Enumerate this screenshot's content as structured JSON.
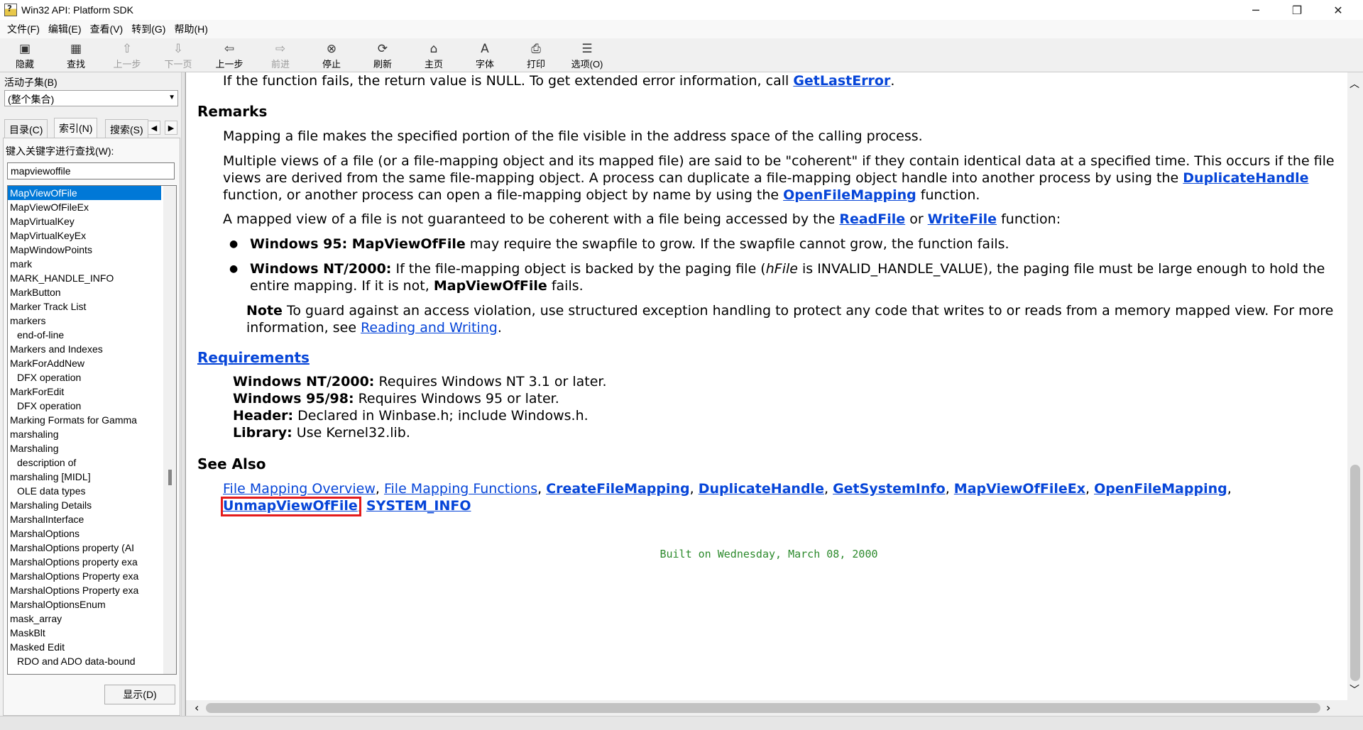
{
  "window": {
    "title": "Win32 API: Platform SDK",
    "minimize": "─",
    "maximize": "❐",
    "close": "✕"
  },
  "menu": [
    "文件(F)",
    "编辑(E)",
    "查看(V)",
    "转到(G)",
    "帮助(H)"
  ],
  "toolbar": [
    {
      "label": "隐藏",
      "icon": "hide-icon",
      "glyph": "▣",
      "enabled": true
    },
    {
      "label": "查找",
      "icon": "find-icon",
      "glyph": "▦",
      "enabled": true
    },
    {
      "label": "上一步",
      "icon": "up-arrow-icon",
      "glyph": "⇧",
      "enabled": false
    },
    {
      "label": "下一页",
      "icon": "down-arrow-icon",
      "glyph": "⇩",
      "enabled": false
    },
    {
      "label": "上一步",
      "icon": "back-arrow-icon",
      "glyph": "⇦",
      "enabled": true
    },
    {
      "label": "前进",
      "icon": "forward-arrow-icon",
      "glyph": "⇨",
      "enabled": false
    },
    {
      "label": "停止",
      "icon": "stop-icon",
      "glyph": "⊗",
      "enabled": true
    },
    {
      "label": "刷新",
      "icon": "refresh-icon",
      "glyph": "⟳",
      "enabled": true
    },
    {
      "label": "主页",
      "icon": "home-icon",
      "glyph": "⌂",
      "enabled": true
    },
    {
      "label": "字体",
      "icon": "font-icon",
      "glyph": "A",
      "enabled": true
    },
    {
      "label": "打印",
      "icon": "print-icon",
      "glyph": "⎙",
      "enabled": true
    },
    {
      "label": "选项(O)",
      "icon": "options-icon",
      "glyph": "☰",
      "enabled": true
    }
  ],
  "left": {
    "subset_label": "活动子集(B)",
    "subset_value": "(整个集合)",
    "tabs": {
      "contents": "目录(C)",
      "index": "索引(N)",
      "search": "搜索(S)"
    },
    "keyword_label": "键入关键字进行查找(W):",
    "keyword_value": "mapviewoffile",
    "items": [
      {
        "t": "MapViewOfFile",
        "sub": false,
        "sel": true
      },
      {
        "t": "MapViewOfFileEx",
        "sub": false,
        "sel": false
      },
      {
        "t": "MapVirtualKey",
        "sub": false,
        "sel": false
      },
      {
        "t": "MapVirtualKeyEx",
        "sub": false,
        "sel": false
      },
      {
        "t": "MapWindowPoints",
        "sub": false,
        "sel": false
      },
      {
        "t": "mark",
        "sub": false,
        "sel": false
      },
      {
        "t": "MARK_HANDLE_INFO",
        "sub": false,
        "sel": false
      },
      {
        "t": "MarkButton",
        "sub": false,
        "sel": false
      },
      {
        "t": "Marker Track List",
        "sub": false,
        "sel": false
      },
      {
        "t": "markers",
        "sub": false,
        "sel": false
      },
      {
        "t": "end-of-line",
        "sub": true,
        "sel": false
      },
      {
        "t": "Markers and Indexes",
        "sub": false,
        "sel": false
      },
      {
        "t": "MarkForAddNew",
        "sub": false,
        "sel": false
      },
      {
        "t": "DFX operation",
        "sub": true,
        "sel": false
      },
      {
        "t": "MarkForEdit",
        "sub": false,
        "sel": false
      },
      {
        "t": "DFX operation",
        "sub": true,
        "sel": false
      },
      {
        "t": "Marking Formats for Gamma",
        "sub": false,
        "sel": false
      },
      {
        "t": "marshaling",
        "sub": false,
        "sel": false
      },
      {
        "t": "Marshaling",
        "sub": false,
        "sel": false
      },
      {
        "t": "description of",
        "sub": true,
        "sel": false
      },
      {
        "t": "marshaling [MIDL]",
        "sub": false,
        "sel": false
      },
      {
        "t": "OLE data types",
        "sub": true,
        "sel": false
      },
      {
        "t": "Marshaling Details",
        "sub": false,
        "sel": false
      },
      {
        "t": "MarshalInterface",
        "sub": false,
        "sel": false
      },
      {
        "t": "MarshalOptions",
        "sub": false,
        "sel": false
      },
      {
        "t": "MarshalOptions property (AI",
        "sub": false,
        "sel": false
      },
      {
        "t": "MarshalOptions property exa",
        "sub": false,
        "sel": false
      },
      {
        "t": "MarshalOptions Property exa",
        "sub": false,
        "sel": false
      },
      {
        "t": "MarshalOptions Property exa",
        "sub": false,
        "sel": false
      },
      {
        "t": "MarshalOptionsEnum",
        "sub": false,
        "sel": false
      },
      {
        "t": "mask_array",
        "sub": false,
        "sel": false
      },
      {
        "t": "MaskBlt",
        "sub": false,
        "sel": false
      },
      {
        "t": "Masked Edit",
        "sub": false,
        "sel": false
      },
      {
        "t": "RDO and ADO data-bound",
        "sub": true,
        "sel": false
      }
    ],
    "display_button": "显示(D)"
  },
  "doc": {
    "fail_text": "If the function fails, the return value is NULL. To get extended error information, call ",
    "fail_link": "GetLastError",
    "remarks_heading": "Remarks",
    "remarks_p1": "Mapping a file makes the specified portion of the file visible in the address space of the calling process.",
    "remarks_p2a": "Multiple views of a file (or a file-mapping object and its mapped file) are said to be \"coherent\" if they contain identical data at a specified time. This occurs if the file views are derived from the same file-mapping object. A process can duplicate a file-mapping object handle into another process by using the ",
    "remarks_p2_link1": "DuplicateHandle",
    "remarks_p2b": " function, or another process can open a file-mapping object by name by using the ",
    "remarks_p2_link2": "OpenFileMapping",
    "remarks_p2c": " function.",
    "remarks_p3a": "A mapped view of a file is not guaranteed to be coherent with a file being accessed by the ",
    "remarks_p3_link1": "ReadFile",
    "remarks_p3_or": " or ",
    "remarks_p3_link2": "WriteFile",
    "remarks_p3b": " function:",
    "bullet1_bold": "Windows 95: MapViewOfFile",
    "bullet1_text": " may require the swapfile to grow. If the swapfile cannot grow, the function fails.",
    "bullet2_bold": "Windows NT/2000:",
    "bullet2_text_a": " If the file-mapping object is backed by the paging file (",
    "bullet2_italic": "hFile",
    "bullet2_text_b": " is INVALID_HANDLE_VALUE), the paging file must be large enough to hold the entire mapping. If it is not, ",
    "bullet2_bold2": "MapViewOfFile",
    "bullet2_text_c": " fails.",
    "note_label": "Note",
    "note_text": "  To guard against an access violation, use structured exception handling to protect any code that writes to or reads from a memory mapped view. For more information, see ",
    "note_link": "Reading and Writing",
    "note_end": ".",
    "requirements_heading": "Requirements",
    "req": [
      {
        "k": "Windows NT/2000:",
        "v": " Requires Windows NT 3.1 or later."
      },
      {
        "k": "Windows 95/98:",
        "v": " Requires Windows 95 or later."
      },
      {
        "k": "Header:",
        "v": " Declared in Winbase.h; include Windows.h."
      },
      {
        "k": "Library:",
        "v": " Use Kernel32.lib."
      }
    ],
    "see_also_heading": "See Also",
    "see_also": [
      {
        "t": "File Mapping Overview",
        "bold": false
      },
      {
        "t": "File Mapping Functions",
        "bold": false
      },
      {
        "t": "CreateFileMapping",
        "bold": true
      },
      {
        "t": "DuplicateHandle",
        "bold": true
      },
      {
        "t": "GetSystemInfo",
        "bold": true
      },
      {
        "t": "MapViewOfFileEx",
        "bold": true
      },
      {
        "t": "OpenFileMapping",
        "bold": true
      },
      {
        "t": "UnmapViewOfFile",
        "bold": true,
        "highlight": true
      },
      {
        "t": "SYSTEM_INFO",
        "bold": true
      }
    ],
    "see_also_sep": ", ",
    "built_on": "Built on Wednesday, March 08, 2000"
  },
  "colors": {
    "link": "#0645d8",
    "highlight": "#e41c1c",
    "built_on": "#2c8a2c",
    "selection": "#0078d7"
  }
}
